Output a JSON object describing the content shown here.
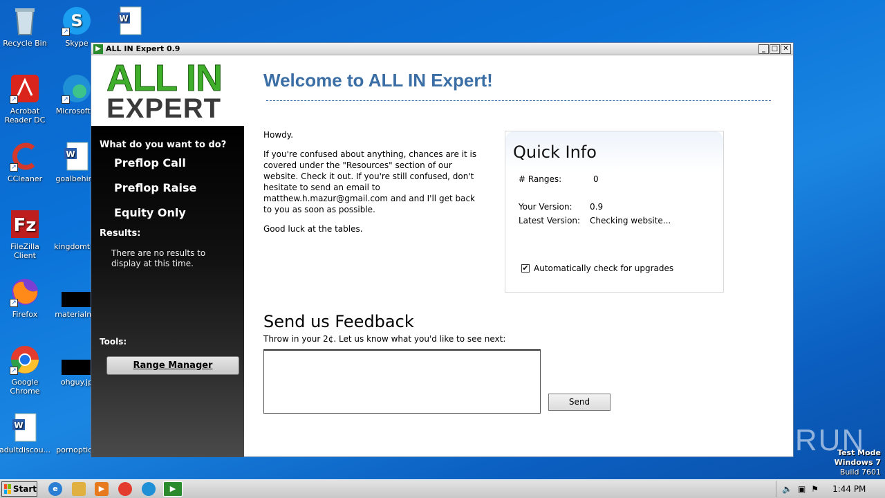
{
  "desktop": {
    "icons": [
      {
        "label": "Recycle Bin",
        "icon": "recycle-bin-icon"
      },
      {
        "label": "Skype",
        "icon": "skype-icon"
      },
      {
        "label": "",
        "icon": "word-doc-icon"
      },
      {
        "label": "Acrobat Reader DC",
        "icon": "acrobat-icon"
      },
      {
        "label": "Microsoft E",
        "icon": "edge-icon"
      },
      {
        "label": "CCleaner",
        "icon": "ccleaner-icon"
      },
      {
        "label": "goalbehind",
        "icon": "word-doc-icon"
      },
      {
        "label": "FileZilla Client",
        "icon": "filezilla-icon"
      },
      {
        "label": "kingdomthe",
        "icon": "blank-file-icon"
      },
      {
        "label": "Firefox",
        "icon": "firefox-icon"
      },
      {
        "label": "materialme",
        "icon": "black-thumbnail-icon"
      },
      {
        "label": "Google Chrome",
        "icon": "chrome-icon"
      },
      {
        "label": "ohguy.jp",
        "icon": "black-thumbnail-icon"
      },
      {
        "label": "adultdiscou...",
        "icon": "word-doc-icon"
      },
      {
        "label": "pornoption",
        "icon": "blank-file-icon"
      }
    ]
  },
  "window": {
    "title": "ALL IN Expert 0.9",
    "buttons": {
      "minimize": "_",
      "maximize": "□",
      "close": "✕"
    }
  },
  "logo": {
    "top": "ALL IN",
    "bottom": "EXPERT"
  },
  "sidebar": {
    "heading": "What do you want to do?",
    "actions": [
      "Preflop Call",
      "Preflop Raise",
      "Equity Only"
    ],
    "results_heading": "Results:",
    "results_text": "There are no results to display at this time.",
    "tools_heading": "Tools:",
    "range_manager": "Range Manager"
  },
  "main": {
    "welcome": "Welcome to ALL IN Expert!",
    "intro": [
      "Howdy.",
      "If you're confused about anything, chances are it is covered under the \"Resources\" section of our website. Check it out. If you're still confused, don't hesitate to send an email to matthew.h.mazur@gmail.com and and I'll get back to you as soon as possible.",
      "Good luck at the tables."
    ]
  },
  "quick_info": {
    "title": "Quick Info",
    "ranges_label": "# Ranges:",
    "ranges_value": "0",
    "your_version_label": "Your Version:",
    "your_version_value": "0.9",
    "latest_version_label": "Latest Version:",
    "latest_version_value": "Checking website...",
    "auto_check_label": "Automatically check for upgrades",
    "auto_check": true
  },
  "feedback": {
    "title": "Send us Feedback",
    "subtitle": "Throw in your 2¢. Let us know what you'd like to see next:",
    "value": "",
    "send": "Send"
  },
  "taskbar": {
    "start": "Start",
    "clock": "1:44 PM"
  },
  "watermark": "ANY RUN",
  "test_mode": {
    "line1": "Test Mode",
    "line2": "Windows 7",
    "line3": "Build 7601"
  },
  "colors": {
    "accent": "#3a6ea5",
    "logo_green": "#3fae2a"
  }
}
